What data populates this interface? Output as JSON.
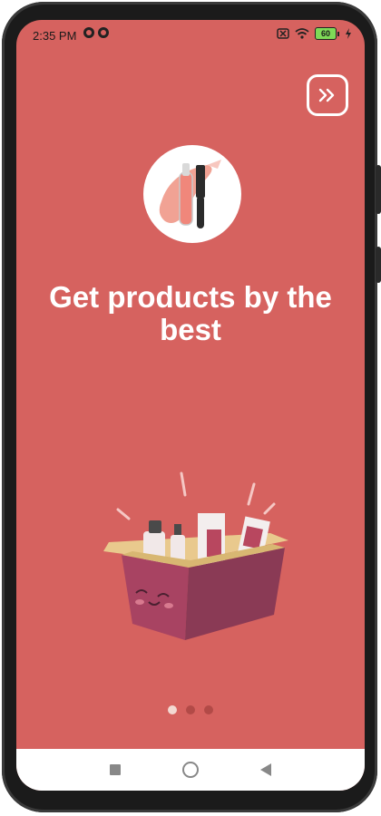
{
  "status_bar": {
    "time": "2:35 PM",
    "battery": "60",
    "icons": [
      "notification-icon",
      "notification-icon",
      "no-sim-icon",
      "wifi-icon",
      "battery-icon",
      "charging-icon"
    ]
  },
  "onboarding": {
    "title": "Get products by the best",
    "skip_icon": "double-chevron-right-icon",
    "page_indicator": {
      "total": 3,
      "current": 1
    }
  },
  "colors": {
    "background": "#d6625f",
    "dot_active": "#f3d9d2",
    "dot_inactive": "#b24a47"
  },
  "nav_bar": {
    "icons": [
      "recent-apps-icon",
      "home-icon",
      "back-icon"
    ]
  }
}
